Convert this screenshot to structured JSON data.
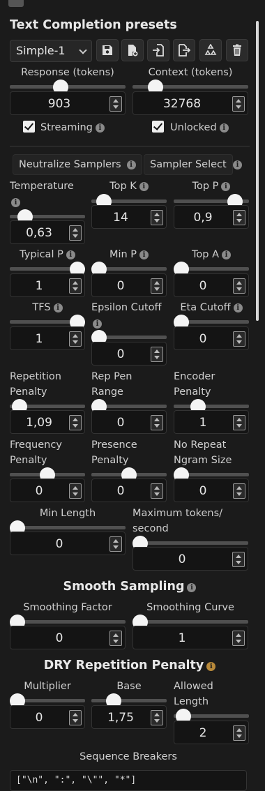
{
  "title": "Text Completion presets",
  "preset": {
    "selected": "Simple-1"
  },
  "toolbar": {
    "icons": [
      "save-icon",
      "new-preset-icon",
      "import-icon",
      "export-icon",
      "restore-icon",
      "delete-icon"
    ]
  },
  "response": {
    "label": "Response (tokens)",
    "value": "903",
    "slider_fraction": 0.55
  },
  "context": {
    "label": "Context (tokens)",
    "value": "32768",
    "slider_fraction": 0.2
  },
  "streaming": {
    "label": "Streaming",
    "checked": true
  },
  "unlocked": {
    "label": "Unlocked",
    "checked": true
  },
  "buttons": {
    "neutralize": "Neutralize Samplers",
    "sampler_select": "Sampler Select"
  },
  "params": {
    "temperature": {
      "label": "Temperature",
      "value": "0,63"
    },
    "top_k": {
      "label": "Top K",
      "value": "14"
    },
    "top_p": {
      "label": "Top P",
      "value": "0,9"
    },
    "typical_p": {
      "label": "Typical P",
      "value": "1"
    },
    "min_p": {
      "label": "Min P",
      "value": "0"
    },
    "top_a": {
      "label": "Top A",
      "value": "0"
    },
    "tfs": {
      "label": "TFS",
      "value": "1"
    },
    "epsilon_cutoff": {
      "label": "Epsilon Cutoff",
      "value": "0"
    },
    "eta_cutoff": {
      "label": "Eta Cutoff",
      "value": "0"
    },
    "repetition_penalty": {
      "label": "Repetition Penalty",
      "value": "1,09"
    },
    "rep_pen_range": {
      "label": "Rep Pen Range",
      "value": "0"
    },
    "encoder_penalty": {
      "label": "Encoder Penalty",
      "value": "1"
    },
    "frequency_penalty": {
      "label": "Frequency Penalty",
      "value": "0"
    },
    "presence_penalty": {
      "label": "Presence Penalty",
      "value": "0"
    },
    "no_repeat_ngram": {
      "label": "No Repeat Ngram Size",
      "value": "0"
    },
    "min_length": {
      "label": "Min Length",
      "value": "0"
    },
    "max_tokens_second": {
      "label": "Maximum tokens/ second",
      "value": "0"
    }
  },
  "smooth": {
    "title": "Smooth Sampling",
    "factor": {
      "label": "Smoothing Factor",
      "value": "0"
    },
    "curve": {
      "label": "Smoothing Curve",
      "value": "1"
    }
  },
  "dry": {
    "title": "DRY Repetition Penalty",
    "multiplier": {
      "label": "Multiplier",
      "value": "0"
    },
    "base": {
      "label": "Base",
      "value": "1,75"
    },
    "allowed_length": {
      "label": "Allowed Length",
      "value": "2"
    },
    "sequence_breakers": {
      "label": "Sequence Breakers",
      "value": "[\"\\n\", \":\", \"\\\"\", \"*\"]"
    }
  },
  "colors": {
    "background": "#1b1b1b",
    "info_gold": "#b8893a"
  }
}
